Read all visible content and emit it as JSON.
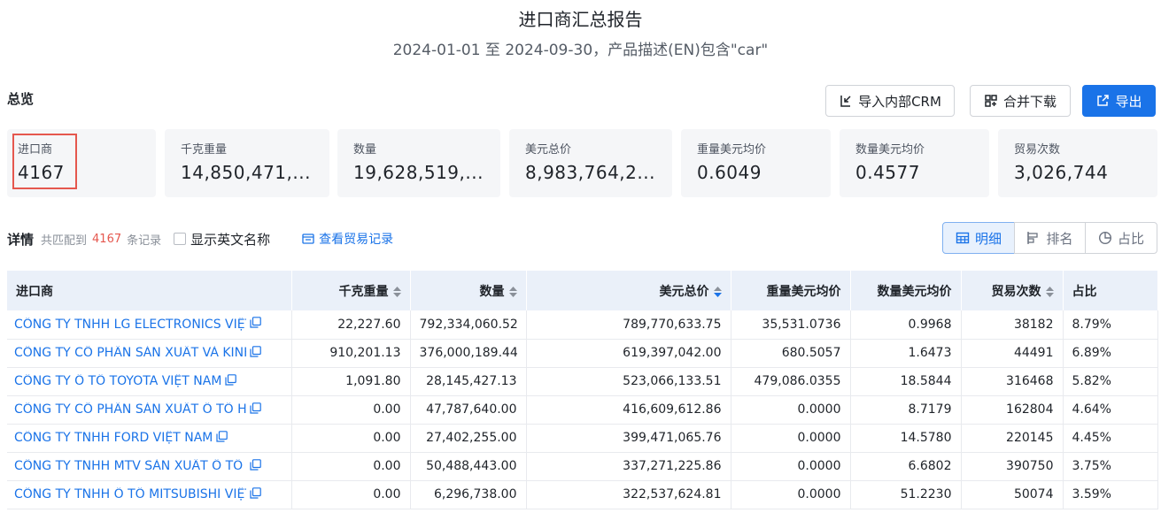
{
  "report": {
    "title": "进口商汇总报告",
    "subtitle": "2024-01-01 至 2024-09-30，产品描述(EN)包含\"car\""
  },
  "overview": {
    "label": "总览",
    "buttons": {
      "crm": "导入内部CRM",
      "merge": "合并下载",
      "export": "导出"
    },
    "stats": [
      {
        "label": "进口商",
        "value": "4167"
      },
      {
        "label": "千克重量",
        "value": "14,850,471,..."
      },
      {
        "label": "数量",
        "value": "19,628,519,..."
      },
      {
        "label": "美元总价",
        "value": "8,983,764,2..."
      },
      {
        "label": "重量美元均价",
        "value": "0.6049"
      },
      {
        "label": "数量美元均价",
        "value": "0.4577"
      },
      {
        "label": "贸易次数",
        "value": "3,026,744"
      }
    ]
  },
  "details": {
    "label": "详情",
    "match_prefix": "共匹配到",
    "match_count": "4167",
    "match_suffix": "条记录",
    "show_english": "显示英文名称",
    "view_records": "查看贸易记录",
    "views": {
      "detail": "明细",
      "rank": "排名",
      "share": "占比"
    }
  },
  "table": {
    "headers": [
      "进口商",
      "千克重量",
      "数量",
      "美元总价",
      "重量美元均价",
      "数量美元均价",
      "贸易次数",
      "占比"
    ],
    "rows": [
      [
        "CÔNG TY TNHH LG ELECTRONICS VIỆT NAM",
        "22,227.60",
        "792,334,060.52",
        "789,770,633.75",
        "35,531.0736",
        "0.9968",
        "38182",
        "8.79%"
      ],
      [
        "CÔNG TY CỔ PHẦN SẢN XUẤT VÀ KINH",
        "910,201.13",
        "376,000,189.44",
        "619,397,042.00",
        "680.5057",
        "1.6473",
        "44491",
        "6.89%"
      ],
      [
        "CÔNG TY Ô TÔ TOYOTA VIỆT NAM",
        "1,091.80",
        "28,145,427.13",
        "523,066,133.51",
        "479,086.0355",
        "18.5844",
        "316468",
        "5.82%"
      ],
      [
        "CÔNG TY CỔ PHẦN SẢN XUẤT Ô TÔ HY",
        "0.00",
        "47,787,640.00",
        "416,609,612.86",
        "0.0000",
        "8.7179",
        "162804",
        "4.64%"
      ],
      [
        "CÔNG TY TNHH FORD VIỆT NAM",
        "0.00",
        "27,402,255.00",
        "399,471,065.76",
        "0.0000",
        "14.5780",
        "220145",
        "4.45%"
      ],
      [
        "CÔNG TY TNHH MTV SẢN XUẤT Ô TÔ T",
        "0.00",
        "50,488,443.00",
        "337,271,225.86",
        "0.0000",
        "6.6802",
        "390750",
        "3.75%"
      ],
      [
        "CÔNG TY TNHH Ô TÔ MITSUBISHI VIỆT",
        "0.00",
        "6,296,738.00",
        "322,537,624.81",
        "0.0000",
        "51.2230",
        "50074",
        "3.59%"
      ]
    ]
  },
  "colors": {
    "accent": "#1a73e8",
    "highlight_border": "#e5574e",
    "header_bg": "#eaf0f9",
    "card_bg": "#f5f6f8"
  }
}
